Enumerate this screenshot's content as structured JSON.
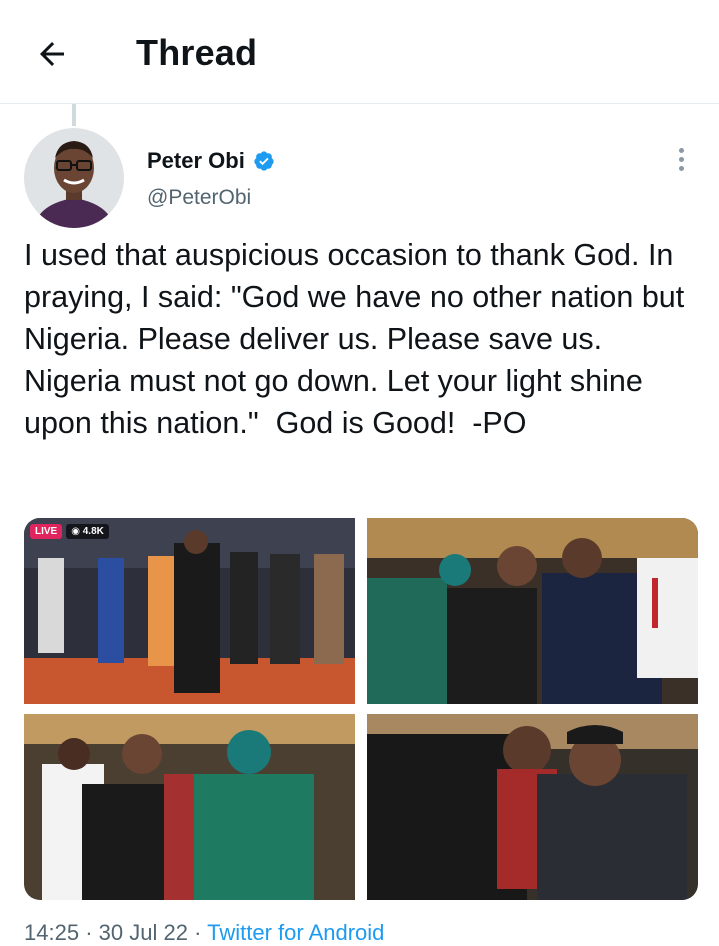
{
  "header": {
    "title": "Thread",
    "back_icon": "arrow-left-icon"
  },
  "tweet": {
    "author_name": "Peter Obi",
    "author_handle": "@PeterObi",
    "verified": true,
    "verified_color": "#1d9bf0",
    "text": "I used that auspicious occasion to thank God. In praying, I said: \"God we have no other nation but Nigeria. Please deliver us. Please save us. Nigeria must not go down. Let your light shine upon this nation.\"  God is Good!  -PO",
    "media": [
      {
        "live_label": "LIVE",
        "view_count": "4.8K"
      },
      {},
      {},
      {}
    ],
    "time": "14:25",
    "date": "30 Jul 22",
    "separator": "·",
    "source": "Twitter for Android"
  },
  "colors": {
    "link": "#1d9bf0",
    "secondary_text": "#536471",
    "live": "#e0245e"
  }
}
